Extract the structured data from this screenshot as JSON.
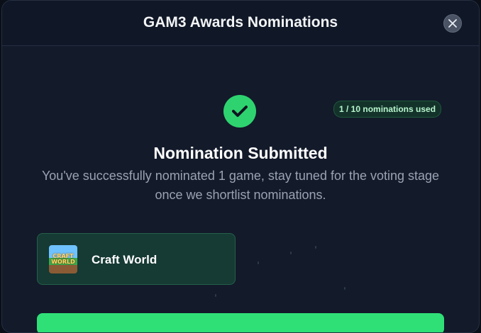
{
  "modal": {
    "title": "GAM3 Awards Nominations",
    "close_icon": "close-icon"
  },
  "status": {
    "icon": "check-icon",
    "badge": "1 / 10 nominations used",
    "headline": "Nomination Submitted",
    "message": "You've successfully nominated 1 game, stay tuned for the voting stage once we shortlist nominations."
  },
  "nominated_games": [
    {
      "name": "Craft World",
      "thumbnail_text": "CRAFT WORLD"
    }
  ],
  "colors": {
    "accent_green": "#2ed36f",
    "card_bg": "#163a34",
    "modal_bg": "#131a2a"
  }
}
